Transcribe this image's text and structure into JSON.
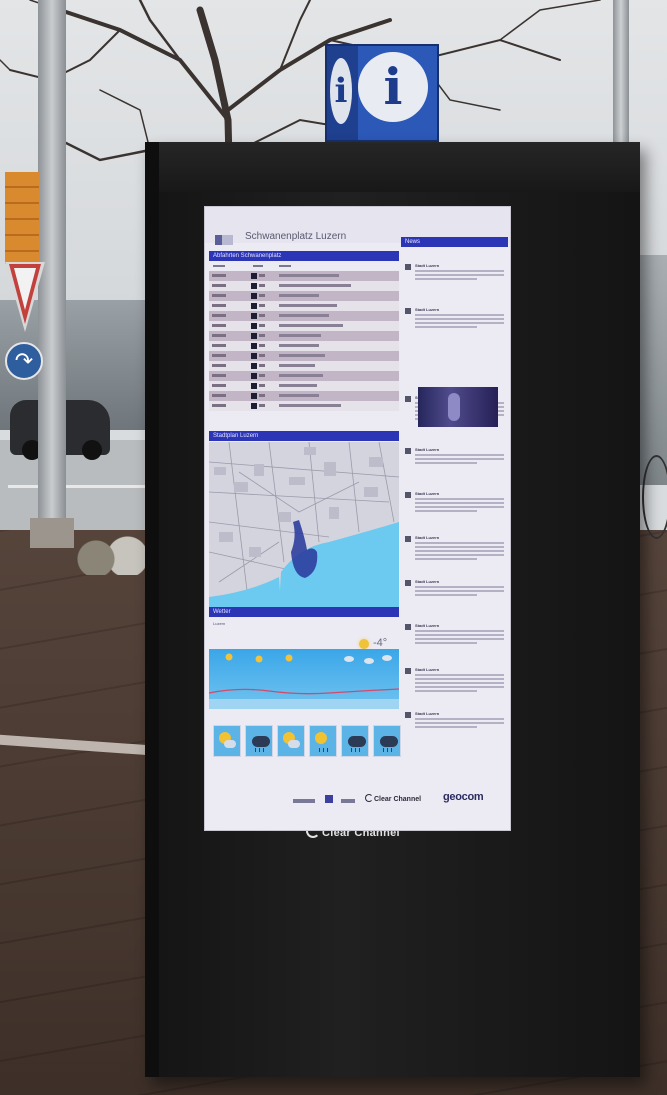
{
  "scene": {
    "info_sign_glyph": "i",
    "kiosk_brand": "Clear Channel"
  },
  "screen": {
    "title": "Schwanenplatz Luzern",
    "departures": {
      "heading": "Abfahrten Schwanenplatz",
      "rows": 14
    },
    "map": {
      "heading": "Stadtplan Luzern"
    },
    "weather": {
      "heading": "Wetter",
      "place": "Luzern",
      "temperature": "-4°"
    },
    "news": {
      "heading": "News",
      "author": "Stadt Luzern",
      "items": 10
    },
    "footer": {
      "clear_channel": "Clear Channel",
      "geocom": "geocom"
    }
  },
  "colors": {
    "kiosk": "#1a1a1a",
    "screen_bg": "#eceaf3",
    "header_bar": "#2c35b6",
    "info_sign_blue": "#2c58b8",
    "table_stripe": "#c2b6c6",
    "lake": "#6cc9f0"
  }
}
